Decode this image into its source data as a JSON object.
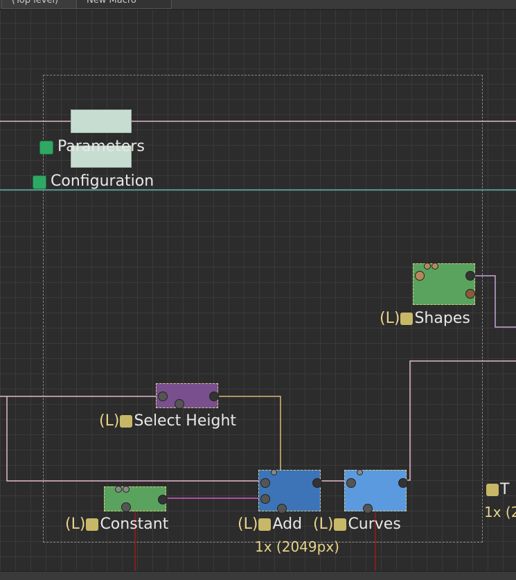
{
  "tabs": [
    {
      "label": "(Top level)"
    },
    {
      "label": "New Macro"
    }
  ],
  "colors": {
    "pink_wire": "#e8b8d0",
    "teal_wire": "#5fb6a8",
    "lilac_wire": "#c9a6dc",
    "orange_wire": "#e2b67a",
    "magenta_wire": "#d85ad0",
    "red_wire": "#a01818",
    "group_border": "#8a8a8a"
  },
  "macro_inputs": [
    {
      "label": "Parameters",
      "icon": "green-square-icon"
    },
    {
      "label": "Configuration",
      "icon": "green-square-icon"
    }
  ],
  "nodes": {
    "shapes": {
      "prefix": "(L)",
      "label": "Shapes",
      "color": "#5aa35e"
    },
    "select_height": {
      "prefix": "(L)",
      "label": "Select Height",
      "color": "#7a4f8e"
    },
    "constant": {
      "prefix": "(L)",
      "label": "Constant",
      "color": "#5aa35e"
    },
    "add": {
      "prefix": "(L)",
      "label": "Add",
      "color": "#3d74b8",
      "resolution": "1x (2049px)"
    },
    "curves": {
      "prefix": "(L)",
      "label": "Curves",
      "color": "#5c9ae0"
    },
    "offscreen": {
      "label": "T",
      "resolution": "1x (2"
    }
  }
}
